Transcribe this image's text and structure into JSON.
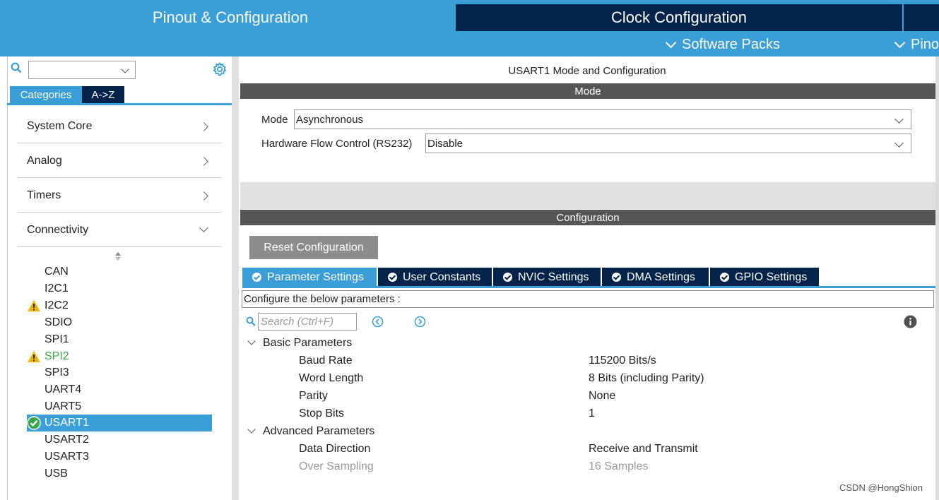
{
  "colors": {
    "accent": "#3a9fd6",
    "dark_navy": "#03234b",
    "header_gray": "#555555",
    "button_gray": "#8c8c8c",
    "warning": "#f2b800",
    "ok_green": "#3aa84a"
  },
  "top_tabs": {
    "pinout": "Pinout & Configuration",
    "clock": "Clock Configuration"
  },
  "top_links": {
    "software_packs": "Software Packs",
    "pinout": "Pino"
  },
  "sidebar": {
    "tabs": {
      "categories": "Categories",
      "az": "A->Z"
    },
    "categories": [
      {
        "label": "System Core",
        "expanded": false
      },
      {
        "label": "Analog",
        "expanded": false
      },
      {
        "label": "Timers",
        "expanded": false
      },
      {
        "label": "Connectivity",
        "expanded": true
      }
    ],
    "peripherals": [
      {
        "label": "CAN",
        "status": "none"
      },
      {
        "label": "I2C1",
        "status": "none"
      },
      {
        "label": "I2C2",
        "status": "warning"
      },
      {
        "label": "SDIO",
        "status": "none"
      },
      {
        "label": "SPI1",
        "status": "none"
      },
      {
        "label": "SPI2",
        "status": "warning"
      },
      {
        "label": "SPI3",
        "status": "none"
      },
      {
        "label": "UART4",
        "status": "none"
      },
      {
        "label": "UART5",
        "status": "none"
      },
      {
        "label": "USART1",
        "status": "ok",
        "selected": true
      },
      {
        "label": "USART2",
        "status": "none"
      },
      {
        "label": "USART3",
        "status": "none"
      },
      {
        "label": "USB",
        "status": "none"
      }
    ]
  },
  "main": {
    "title": "USART1 Mode and Configuration",
    "mode_header": "Mode",
    "mode_field": {
      "label": "Mode",
      "value": "Asynchronous"
    },
    "flow_field": {
      "label": "Hardware Flow Control (RS232)",
      "value": "Disable"
    },
    "config_header": "Configuration",
    "reset_button": "Reset Configuration",
    "tabs": [
      {
        "label": "Parameter Settings",
        "active": true
      },
      {
        "label": "User Constants",
        "active": false
      },
      {
        "label": "NVIC Settings",
        "active": false
      },
      {
        "label": "DMA Settings",
        "active": false
      },
      {
        "label": "GPIO Settings",
        "active": false
      }
    ],
    "description": "Configure the below parameters :",
    "search_placeholder": "Search (Ctrl+F)",
    "groups": [
      {
        "label": "Basic Parameters",
        "params": [
          {
            "name": "Baud Rate",
            "value": "115200 Bits/s",
            "enabled": true
          },
          {
            "name": "Word Length",
            "value": "8 Bits (including Parity)",
            "enabled": true
          },
          {
            "name": "Parity",
            "value": "None",
            "enabled": true
          },
          {
            "name": "Stop Bits",
            "value": "1",
            "enabled": true
          }
        ]
      },
      {
        "label": "Advanced Parameters",
        "params": [
          {
            "name": "Data Direction",
            "value": "Receive and Transmit",
            "enabled": true
          },
          {
            "name": "Over Sampling",
            "value": "16 Samples",
            "enabled": false
          }
        ]
      }
    ]
  },
  "watermark": "CSDN @HongShion"
}
